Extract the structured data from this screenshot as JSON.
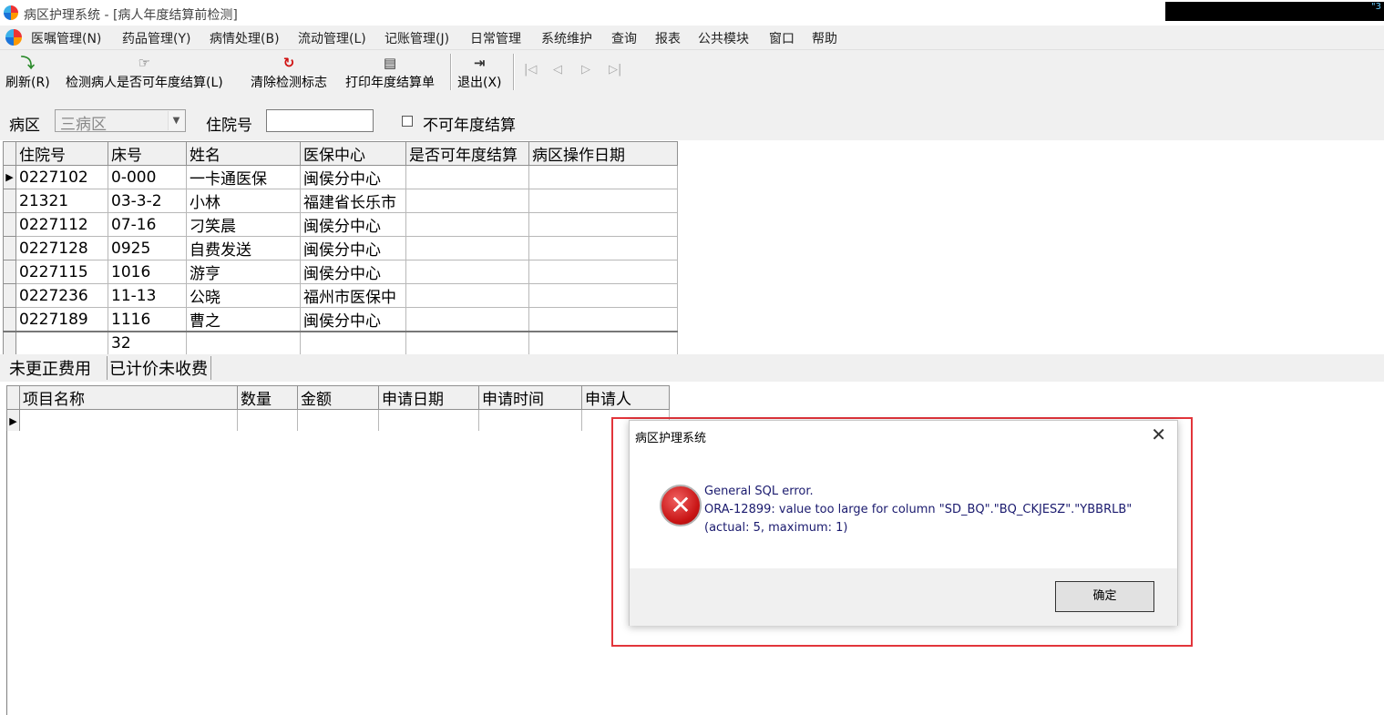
{
  "window": {
    "title": "病区护理系统 - [病人年度结算前检测]",
    "corner_text": "\"3"
  },
  "menu": [
    "医嘱管理(N)",
    "药品管理(Y)",
    "病情处理(B)",
    "流动管理(L)",
    "记账管理(J)",
    "日常管理",
    "系统维护",
    "查询",
    "报表",
    "公共模块",
    "窗口",
    "帮助"
  ],
  "toolbar": {
    "refresh": "刷新(R)",
    "check": "检测病人是否可年度结算(L)",
    "clear": "清除检测标志",
    "print": "打印年度结算单",
    "exit": "退出(X)"
  },
  "filter": {
    "ward_label": "病区",
    "ward_value": "三病区",
    "admission_label": "住院号",
    "admission_value": "",
    "checkbox_label": "不可年度结算"
  },
  "patients": {
    "columns": [
      "住院号",
      "床号",
      "姓名",
      "医保中心",
      "是否可年度结算",
      "病区操作日期"
    ],
    "rows": [
      [
        "0227102",
        "0-000",
        "一卡通医保",
        "闽侯分中心",
        "",
        ""
      ],
      [
        "21321",
        "03-3-2",
        "小林",
        "福建省长乐市",
        "",
        ""
      ],
      [
        "0227112",
        "07-16",
        "刁笑晨",
        "闽侯分中心",
        "",
        ""
      ],
      [
        "0227128",
        "0925",
        "自费发送",
        "闽侯分中心",
        "",
        ""
      ],
      [
        "0227115",
        "1016",
        "游亨",
        "闽侯分中心",
        "",
        ""
      ],
      [
        "0227236",
        "11-13",
        "公晓",
        "福州市医保中",
        "",
        ""
      ],
      [
        "0227189",
        "1116",
        "曹之",
        "闽侯分中心",
        "",
        ""
      ]
    ],
    "footer": [
      "",
      "32",
      "",
      "",
      "",
      ""
    ]
  },
  "tabs": [
    "未更正费用",
    "已计价未收费"
  ],
  "fees": {
    "columns": [
      "项目名称",
      "数量",
      "金额",
      "申请日期",
      "申请时间",
      "申请人"
    ]
  },
  "dialog": {
    "title": "病区护理系统",
    "line1": "General SQL error.",
    "line2": "ORA-12899: value too large for column \"SD_BQ\".\"BQ_CKJESZ\".\"YBBRLB\"",
    "line3": "(actual: 5, maximum: 1)",
    "ok": "确定"
  }
}
